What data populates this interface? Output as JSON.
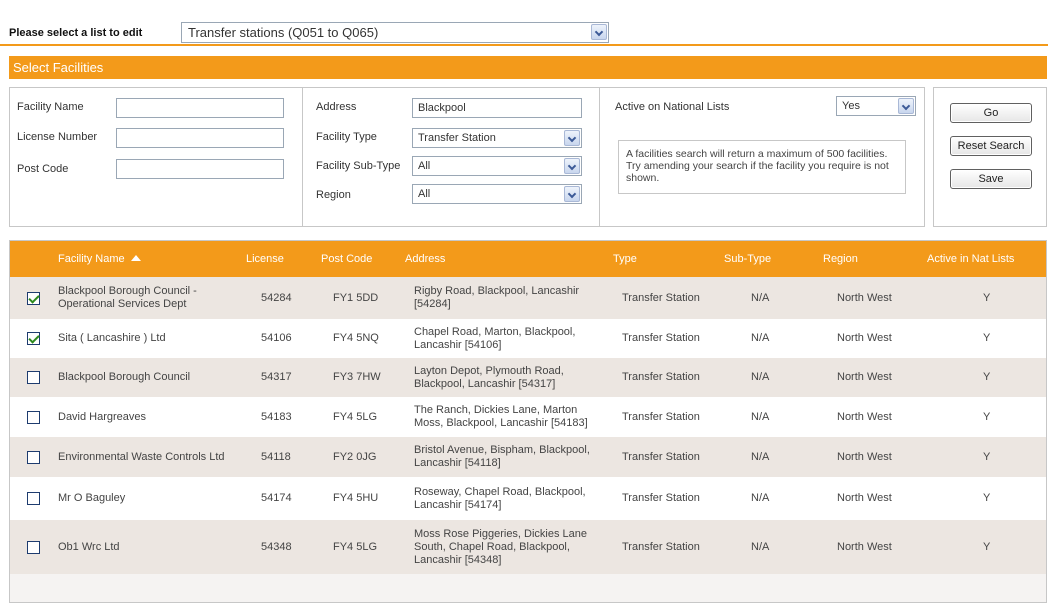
{
  "list_selector": {
    "label": "Please select a list to edit",
    "selected": "Transfer stations (Q051 to Q065)"
  },
  "section_title": "Select Facilities",
  "search": {
    "facility_name_label": "Facility Name",
    "facility_name_value": "",
    "license_label": "License Number",
    "license_value": "",
    "postcode_label": "Post Code",
    "postcode_value": "",
    "address_label": "Address",
    "address_value": "Blackpool",
    "type_label": "Facility Type",
    "type_value": "Transfer Station",
    "subtype_label": "Facility Sub-Type",
    "subtype_value": "All",
    "region_label": "Region",
    "region_value": "All",
    "active_label": "Active on National Lists",
    "active_value": "Yes",
    "note": "A facilities search will return a maximum of 500 facilities.  Try amending your search if the facility you require is not shown."
  },
  "buttons": {
    "go": "Go",
    "reset": "Reset Search",
    "save": "Save"
  },
  "table": {
    "headers": {
      "name": "Facility Name",
      "license": "License",
      "postcode": "Post Code",
      "address": "Address",
      "type": "Type",
      "subtype": "Sub-Type",
      "region": "Region",
      "active": "Active in Nat Lists"
    },
    "rows": [
      {
        "checked": true,
        "name": "Blackpool Borough Council - Operational Services Dept",
        "license": "54284",
        "postcode": "FY1 5DD",
        "address": "Rigby Road, Blackpool, Lancashir [54284]",
        "type": "Transfer Station",
        "subtype": "N/A",
        "region": "North West",
        "active": "Y"
      },
      {
        "checked": true,
        "name": "Sita ( Lancashire ) Ltd",
        "license": "54106",
        "postcode": "FY4 5NQ",
        "address": "Chapel Road, Marton, Blackpool, Lancashir [54106]",
        "type": "Transfer Station",
        "subtype": "N/A",
        "region": "North West",
        "active": "Y"
      },
      {
        "checked": false,
        "name": "Blackpool Borough Council",
        "license": "54317",
        "postcode": "FY3 7HW",
        "address": "Layton Depot, Plymouth Road, Blackpool, Lancashir [54317]",
        "type": "Transfer Station",
        "subtype": "N/A",
        "region": "North West",
        "active": "Y"
      },
      {
        "checked": false,
        "name": "David Hargreaves",
        "license": "54183",
        "postcode": "FY4 5LG",
        "address": "The Ranch, Dickies Lane, Marton Moss, Blackpool, Lancashir [54183]",
        "type": "Transfer Station",
        "subtype": "N/A",
        "region": "North West",
        "active": "Y"
      },
      {
        "checked": false,
        "name": "Environmental Waste Controls Ltd",
        "license": "54118",
        "postcode": "FY2 0JG",
        "address": "Bristol Avenue, Bispham, Blackpool, Lancashir [54118]",
        "type": "Transfer Station",
        "subtype": "N/A",
        "region": "North West",
        "active": "Y"
      },
      {
        "checked": false,
        "name": "Mr O Baguley",
        "license": "54174",
        "postcode": "FY4 5HU",
        "address": "Roseway, Chapel Road, Blackpool, Lancashir [54174]",
        "type": "Transfer Station",
        "subtype": "N/A",
        "region": "North West",
        "active": "Y"
      },
      {
        "checked": false,
        "name": "Ob1 Wrc Ltd",
        "license": "54348",
        "postcode": "FY4 5LG",
        "address": "Moss Rose Piggeries, Dickies Lane South, Chapel Road, Blackpool, Lancashir [54348]",
        "type": "Transfer Station",
        "subtype": "N/A",
        "region": "North West",
        "active": "Y"
      }
    ]
  },
  "colors": {
    "accent": "#f39a1a",
    "row_alt": "#ece6e1",
    "check": "#2d8a1e"
  },
  "icons": {
    "sort": "sort-ascending-icon",
    "dropdown": "chevron-down-icon",
    "checkbox": "checkbox-icon"
  }
}
